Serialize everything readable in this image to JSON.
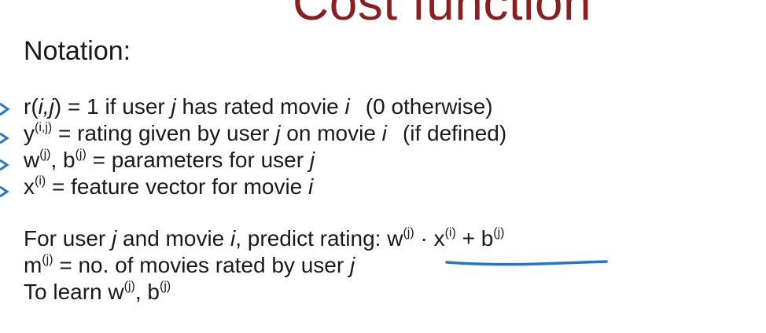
{
  "slide": {
    "title": "Cost function",
    "heading": "Notation:",
    "ink_color": "#1f77d0",
    "title_color": "#8b1e1e"
  },
  "lines": {
    "r_a": "r(",
    "r_ij": "i,j",
    "r_b": ") = 1  if user ",
    "r_j": "j",
    "r_c": " has rated movie ",
    "r_i": "i",
    "r_d": "(0 otherwise)",
    "y_a": "y",
    "y_sup": "(i,j)",
    "y_b": " = rating given by user ",
    "y_j": "j",
    "y_c": " on movie ",
    "y_i": "i",
    "y_d": "(if defined)",
    "w_a": "w",
    "w_sup": "(j)",
    "w_b": ", b",
    "w_sup2": "(j)",
    "w_c": " = parameters for user ",
    "w_j": "j",
    "x_a": "x",
    "x_sup": "(i)",
    "x_b": " = feature vector for movie ",
    "x_i": "i",
    "p_a": "For user ",
    "p_j": "j",
    "p_b": " and movie ",
    "p_i": "i",
    "p_c": ", predict rating: ",
    "p_w": "w",
    "p_wsup": "(j)",
    "p_dot": " · x",
    "p_xsup": "(i)",
    "p_plus": " + b",
    "p_bsup": "(j)",
    "m_a": "m",
    "m_sup": "(j)",
    "m_b": " = no. of movies rated by user ",
    "m_j": "j",
    "l_a": "To learn w",
    "l_sup": "(j)",
    "l_b": ", b",
    "l_sup2": "(j)"
  }
}
